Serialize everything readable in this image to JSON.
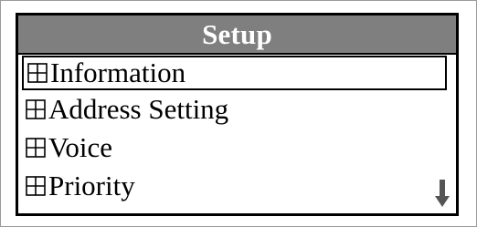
{
  "screen": {
    "title": "Setup"
  },
  "menu": {
    "items": [
      {
        "label": "Information",
        "icon": "expand-box-icon",
        "selected": true
      },
      {
        "label": "Address Setting",
        "icon": "expand-box-icon",
        "selected": false
      },
      {
        "label": "Voice",
        "icon": "expand-box-icon",
        "selected": false
      },
      {
        "label": "Priority",
        "icon": "expand-box-icon",
        "selected": false
      }
    ]
  },
  "scroll": {
    "icon": "scroll-down-arrow-icon"
  },
  "colors": {
    "title_bar": "#7f7f7f",
    "title_text": "#ffffff",
    "border": "#000000"
  }
}
